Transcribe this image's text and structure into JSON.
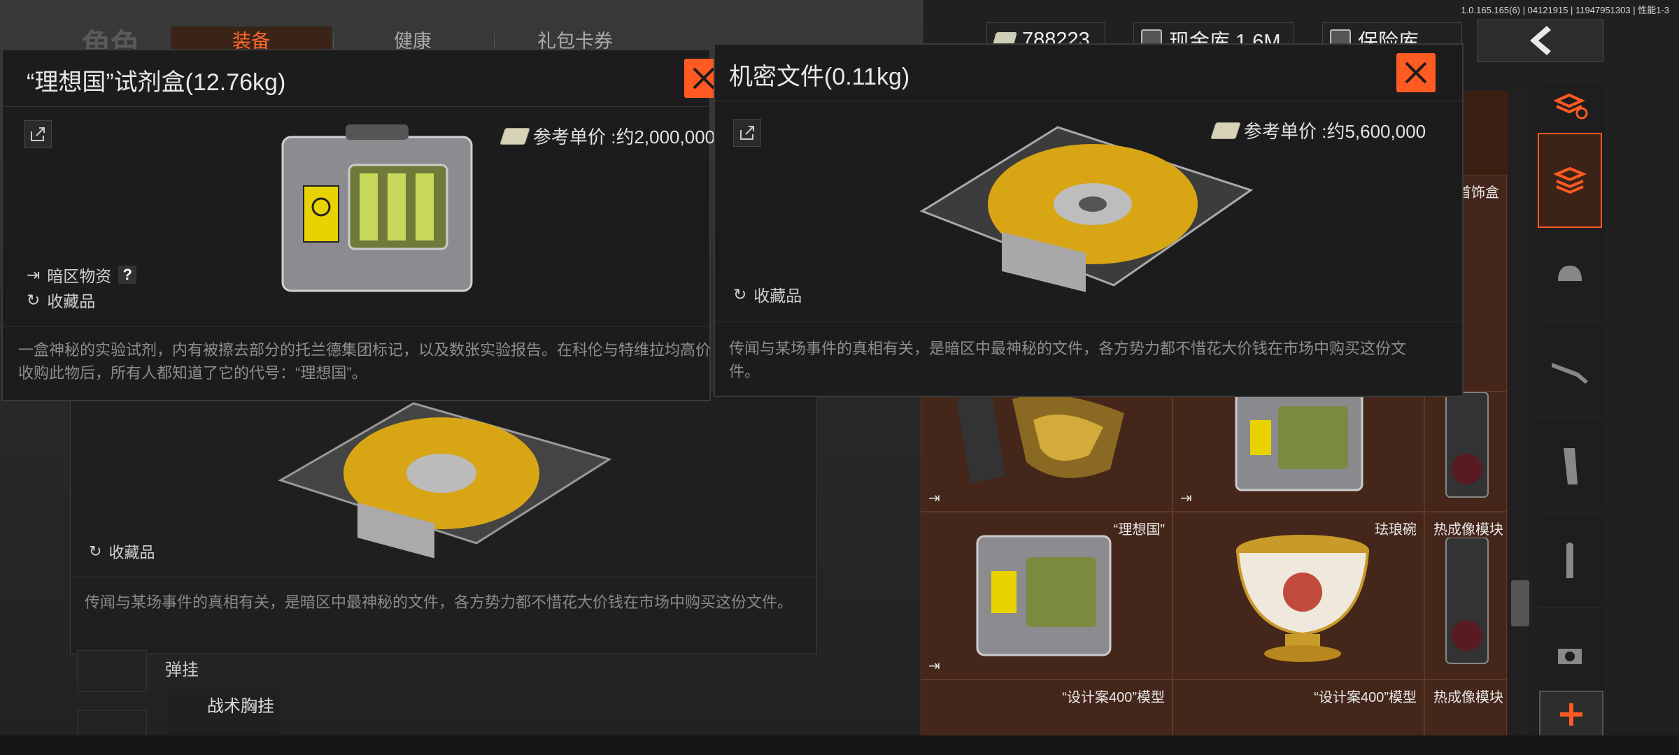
{
  "version_info": "1.0.165.165(6) | 04121915 | 11947951303 | 性能1-3",
  "nav": {
    "role_title": "角色",
    "tabs": [
      {
        "label": "装备",
        "active": true
      },
      {
        "label": "健康",
        "active": false
      },
      {
        "label": "礼包卡券",
        "active": false
      }
    ]
  },
  "currency": {
    "credits": "788223",
    "cash_storage": "现金库 1.6M",
    "safe": "保险库"
  },
  "popup_left": {
    "title": "“理想国”试剂盒(12.76kg)",
    "price_label": "参考单价 :约2,000,000",
    "tags": [
      "暗区物资",
      "收藏品"
    ],
    "help": "?",
    "description": "一盒神秘的实验试剂，内有被擦去部分的托兰德集团标记，以及数张实验报告。在科伦与特维拉均高价收购此物后，所有人都知道了它的代号：“理想国”。"
  },
  "popup_right": {
    "title": "机密文件(0.11kg)",
    "price_label": "参考单价 :约5,600,000",
    "tags": [
      "收藏品"
    ],
    "description": "传闻与某场事件的真相有关，是暗区中最神秘的文件，各方势力都不惜花大价钱在市场中购买这份文件。"
  },
  "card_behind": {
    "tag": "收藏品",
    "description": "传闻与某场事件的真相有关，是暗区中最神秘的文件，各方势力都不惜花大价钱在市场中购买这份文件。"
  },
  "left_lower": {
    "slot_label": "弹挂",
    "item_label": "战术胸挂"
  },
  "inventory": {
    "cells": [
      {
        "name": "首饰盒"
      },
      {
        "name": "热成像模块"
      },
      {
        "name": "“理想国”"
      },
      {
        "name": "珐琅碗"
      },
      {
        "name": "热成像模块"
      },
      {
        "name": "“设计案400”模型"
      },
      {
        "name": "“设计案400”模型"
      },
      {
        "name": "热成像模块"
      }
    ]
  },
  "colors": {
    "accent": "#ff5a22",
    "inventory_bg": "#45261a",
    "popup_bg": "#1c1c1c"
  }
}
